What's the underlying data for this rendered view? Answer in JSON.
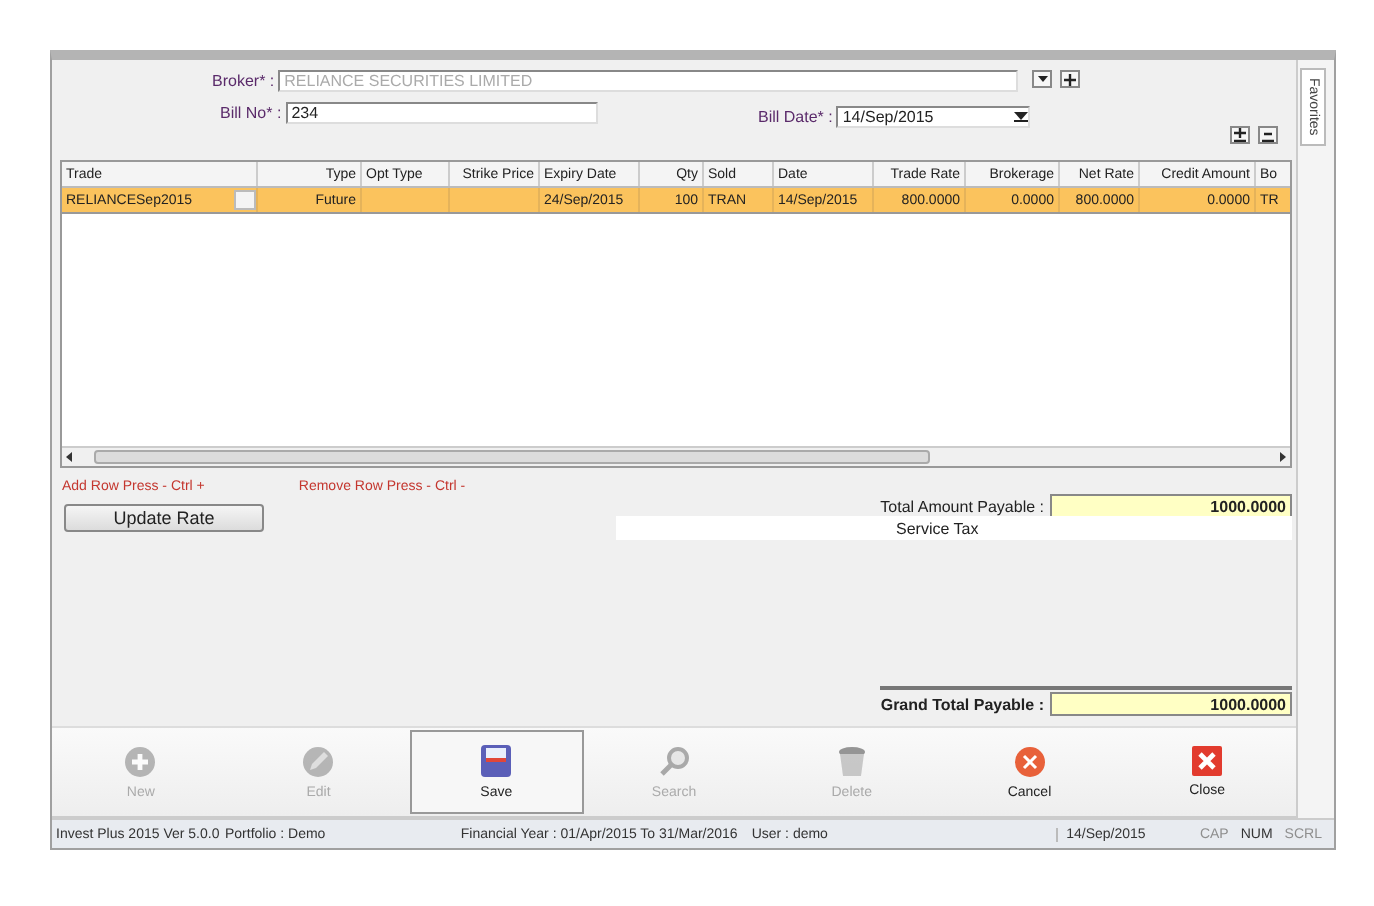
{
  "form": {
    "broker_label": "Broker* :",
    "broker_value": "RELIANCE SECURITIES LIMITED",
    "bill_no_label": "Bill No* :",
    "bill_no_value": "234",
    "bill_date_label": "Bill Date* :",
    "bill_date_value": "14/Sep/2015"
  },
  "side_tab": {
    "label": "Favorites"
  },
  "table": {
    "columns": [
      "Trade",
      "Type",
      "Opt Type",
      "Strike Price",
      "Expiry Date",
      "Qty",
      "Sold",
      "Date",
      "Trade Rate",
      "Brokerage",
      "Net Rate",
      "Credit Amount",
      "Bo"
    ],
    "rows": [
      {
        "selected": true,
        "cells": [
          "RELIANCESep2015",
          "Future",
          null,
          null,
          "24/Sep/2015",
          "100",
          "TRAN",
          "14/Sep/2015",
          "800.0000",
          "0.0000",
          "800.0000",
          "0.0000",
          "TR"
        ]
      }
    ]
  },
  "hints": {
    "add_row": "Add Row Press - Ctrl +",
    "remove_row": "Remove Row Press - Ctrl -"
  },
  "update_button": "Update Rate",
  "totals": {
    "total_label": "Total Amount Payable :",
    "total_value": "1000.0000",
    "service_tax": "Service Tax",
    "grand_label": "Grand Total Payable :",
    "grand_value": "1000.0000"
  },
  "toolbar": [
    {
      "kind": "new",
      "label": "New",
      "disabled": true,
      "selected": false
    },
    {
      "kind": "edit",
      "label": "Edit",
      "disabled": true,
      "selected": false
    },
    {
      "kind": "save",
      "label": "Save",
      "disabled": false,
      "selected": true
    },
    {
      "kind": "search",
      "label": "Search",
      "disabled": true,
      "selected": false
    },
    {
      "kind": "delete",
      "label": "Delete",
      "disabled": true,
      "selected": false
    },
    {
      "kind": "cancel",
      "label": "Cancel",
      "disabled": false,
      "selected": false
    },
    {
      "kind": "close",
      "label": "Close",
      "disabled": false,
      "selected": false
    }
  ],
  "status_bar": {
    "app": "Invest Plus 2015 Ver 5.0.0",
    "portfolio": "Portfolio : Demo",
    "financial_year": "Financial Year : 01/Apr/2015 To 31/Mar/2016",
    "user": "User : demo",
    "date": "14/Sep/2015",
    "indicators": [
      {
        "label": "CAP",
        "on": false
      },
      {
        "label": "NUM",
        "on": true
      },
      {
        "label": "SCRL",
        "on": false
      }
    ]
  }
}
